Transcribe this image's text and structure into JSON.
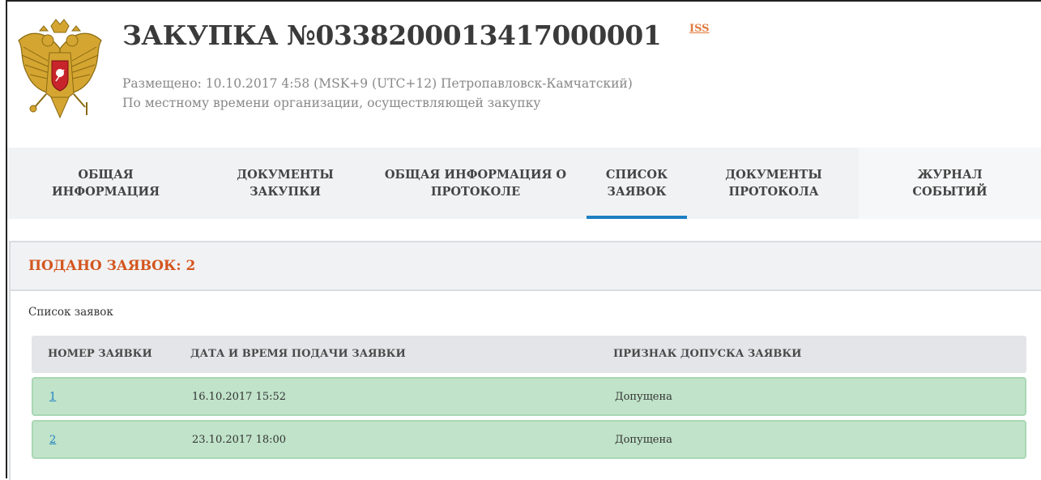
{
  "header": {
    "title": "ЗАКУПКА №0338200013417000001",
    "iss_link": "ISS",
    "posted_line": "Размещено: 10.10.2017 4:58 (MSK+9 (UTC+12) Петропавловск-Камчатский)",
    "timezone_note": "По местному времени организации, осуществляющей закупку",
    "emblem_icon": "russian-coat-of-arms-icon"
  },
  "tabs": [
    {
      "label": "ОБЩАЯ\nИНФОРМАЦИЯ",
      "active": false
    },
    {
      "label": "ДОКУМЕНТЫ\nЗАКУПКИ",
      "active": false
    },
    {
      "label": "ОБЩАЯ ИНФОРМАЦИЯ О\nПРОТОКОЛЕ",
      "active": false
    },
    {
      "label": "СПИСОК\nЗАЯВОК",
      "active": true
    },
    {
      "label": "ДОКУМЕНТЫ\nПРОТОКОЛА",
      "active": false
    },
    {
      "label": "ЖУРНАЛ\nСОБЫТИЙ",
      "active": false
    }
  ],
  "panel": {
    "title": "ПОДАНО ЗАЯВОК: 2",
    "caption": "Список заявок"
  },
  "table": {
    "columns": [
      "НОМЕР ЗАЯВКИ",
      "ДАТА И ВРЕМЯ ПОДАЧИ ЗАЯВКИ",
      "ПРИЗНАК ДОПУСКА ЗАЯВКИ"
    ],
    "rows": [
      {
        "number": "1",
        "datetime": "16.10.2017 15:52",
        "status": "Допущена"
      },
      {
        "number": "2",
        "datetime": "23.10.2017 18:00",
        "status": "Допущена"
      }
    ]
  },
  "colors": {
    "accent": "#1e7fc3",
    "title_orange": "#d3551e",
    "row_green": "#c0e3c9",
    "iss_orange": "#e07a3c"
  }
}
